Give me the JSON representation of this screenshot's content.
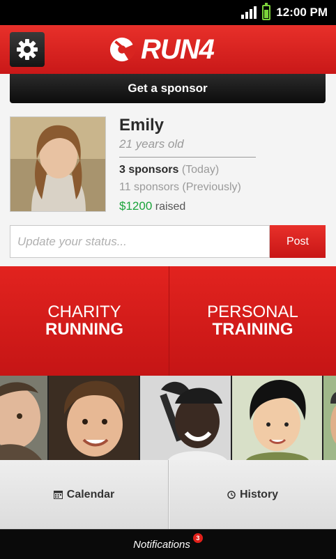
{
  "status_bar": {
    "time": "12:00 PM",
    "signal_icon": "signal-icon",
    "battery_icon": "battery-icon"
  },
  "header": {
    "brand": "RUN4",
    "logo_icon": "run4-logo-icon",
    "settings_icon": "gear-icon",
    "color": "#d82420"
  },
  "sponsor_button": {
    "label": "Get a sponsor"
  },
  "profile": {
    "name": "Emily",
    "age": "21 years old",
    "sponsors_today_count": "3 sponsors",
    "sponsors_today_suffix": "(Today)",
    "sponsors_previous": "11 sponsors (Previously)",
    "raised_amount": "$1200",
    "raised_label": "raised",
    "amount_color": "#1aa33a"
  },
  "status_update": {
    "placeholder": "Update your status...",
    "value": "",
    "post_label": "Post"
  },
  "tiles": {
    "charity": {
      "line1": "CHARITY",
      "line2": "RUNNING"
    },
    "personal": {
      "line1": "PERSONAL",
      "line2": "TRAINING"
    }
  },
  "people_strip": {
    "count": 5
  },
  "bottom_nav": {
    "calendar": {
      "label": "Calendar",
      "icon": "calendar-icon"
    },
    "history": {
      "label": "History",
      "icon": "clock-icon"
    }
  },
  "notifications": {
    "label": "Notifications",
    "count": "3"
  }
}
